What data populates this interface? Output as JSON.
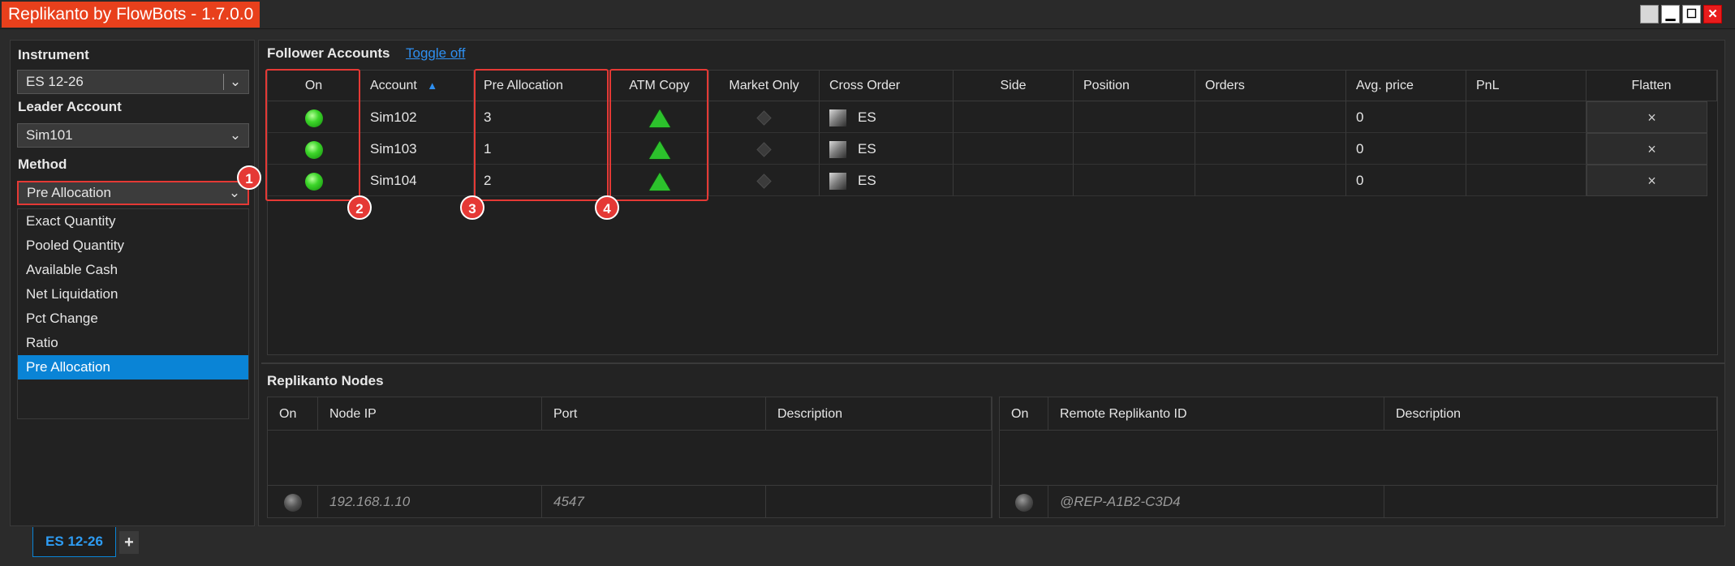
{
  "window": {
    "title": "Replikanto by FlowBots - 1.7.0.0",
    "controls": [
      "minimize",
      "maximize",
      "close"
    ]
  },
  "left_panel": {
    "instrument_label": "Instrument",
    "instrument_value": "ES 12-26",
    "leader_label": "Leader Account",
    "leader_value": "Sim101",
    "method_label": "Method",
    "method_value": "Pre Allocation",
    "method_options": [
      "Exact Quantity",
      "Pooled Quantity",
      "Available Cash",
      "Net Liquidation",
      "Pct Change",
      "Ratio",
      "Pre Allocation"
    ],
    "selected_option": "Pre Allocation"
  },
  "follower": {
    "title": "Follower Accounts",
    "toggle_label": "Toggle off",
    "columns": [
      "On",
      "Account",
      "Pre Allocation",
      "ATM Copy",
      "Market Only",
      "Cross Order",
      "Side",
      "Position",
      "Orders",
      "Avg. price",
      "PnL",
      "Flatten"
    ],
    "rows": [
      {
        "account": "Sim102",
        "pre_allocation": "3",
        "cross_order": "ES",
        "avg_price": "0",
        "flatten": "×"
      },
      {
        "account": "Sim103",
        "pre_allocation": "1",
        "cross_order": "ES",
        "avg_price": "0",
        "flatten": "×"
      },
      {
        "account": "Sim104",
        "pre_allocation": "2",
        "cross_order": "ES",
        "avg_price": "0",
        "flatten": "×"
      }
    ]
  },
  "callouts": [
    "1",
    "2",
    "3",
    "4"
  ],
  "nodes": {
    "title": "Replikanto Nodes",
    "left_columns": [
      "On",
      "Node IP",
      "Port",
      "Description"
    ],
    "left_row": {
      "ip": "192.168.1.10",
      "port": "4547",
      "description": ""
    },
    "right_columns": [
      "On",
      "Remote Replikanto ID",
      "Description"
    ],
    "right_row": {
      "remote_id": "@REP-A1B2-C3D4",
      "description": ""
    }
  },
  "tabs": {
    "active": "ES 12-26",
    "add": "+"
  },
  "colors": {
    "accent": "#e8401c",
    "selection": "#0a84d6",
    "highlight": "#e53935",
    "link": "#2e8ff0"
  }
}
